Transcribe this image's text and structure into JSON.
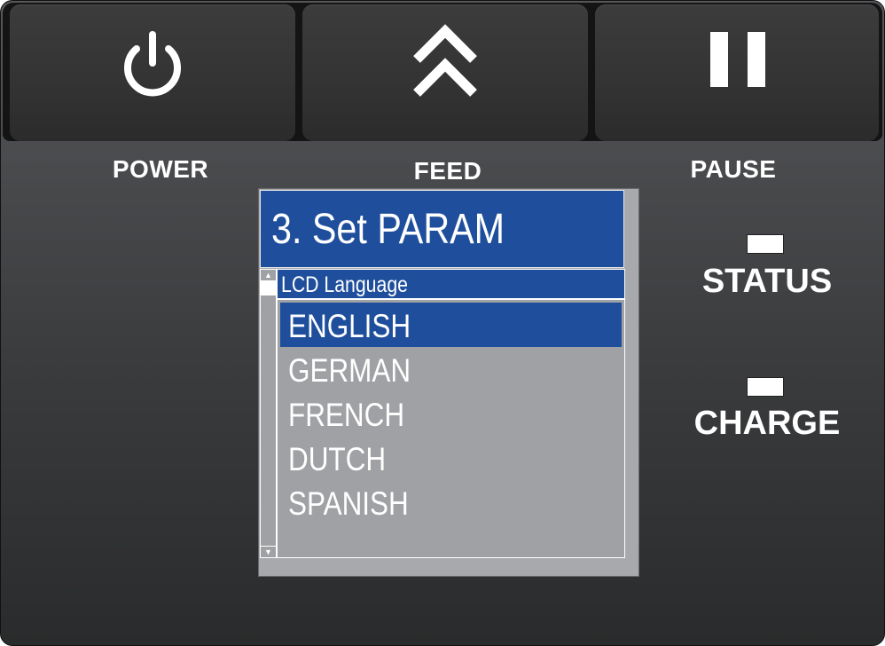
{
  "buttons": {
    "power": {
      "label": "POWER",
      "icon": "power-icon"
    },
    "feed": {
      "label": "FEED",
      "icon": "double-chevron-up-icon"
    },
    "pause": {
      "label": "PAUSE",
      "icon": "pause-icon"
    }
  },
  "lcd": {
    "title": "3. Set PARAM",
    "subheader": "LCD Language",
    "options": [
      "ENGLISH",
      "GERMAN",
      "FRENCH",
      "DUTCH",
      "SPANISH"
    ],
    "selected": "ENGLISH",
    "colors": {
      "highlight": "#1f4f9c",
      "background": "#a0a1a4"
    }
  },
  "indicators": {
    "status": "STATUS",
    "charge": "CHARGE"
  }
}
